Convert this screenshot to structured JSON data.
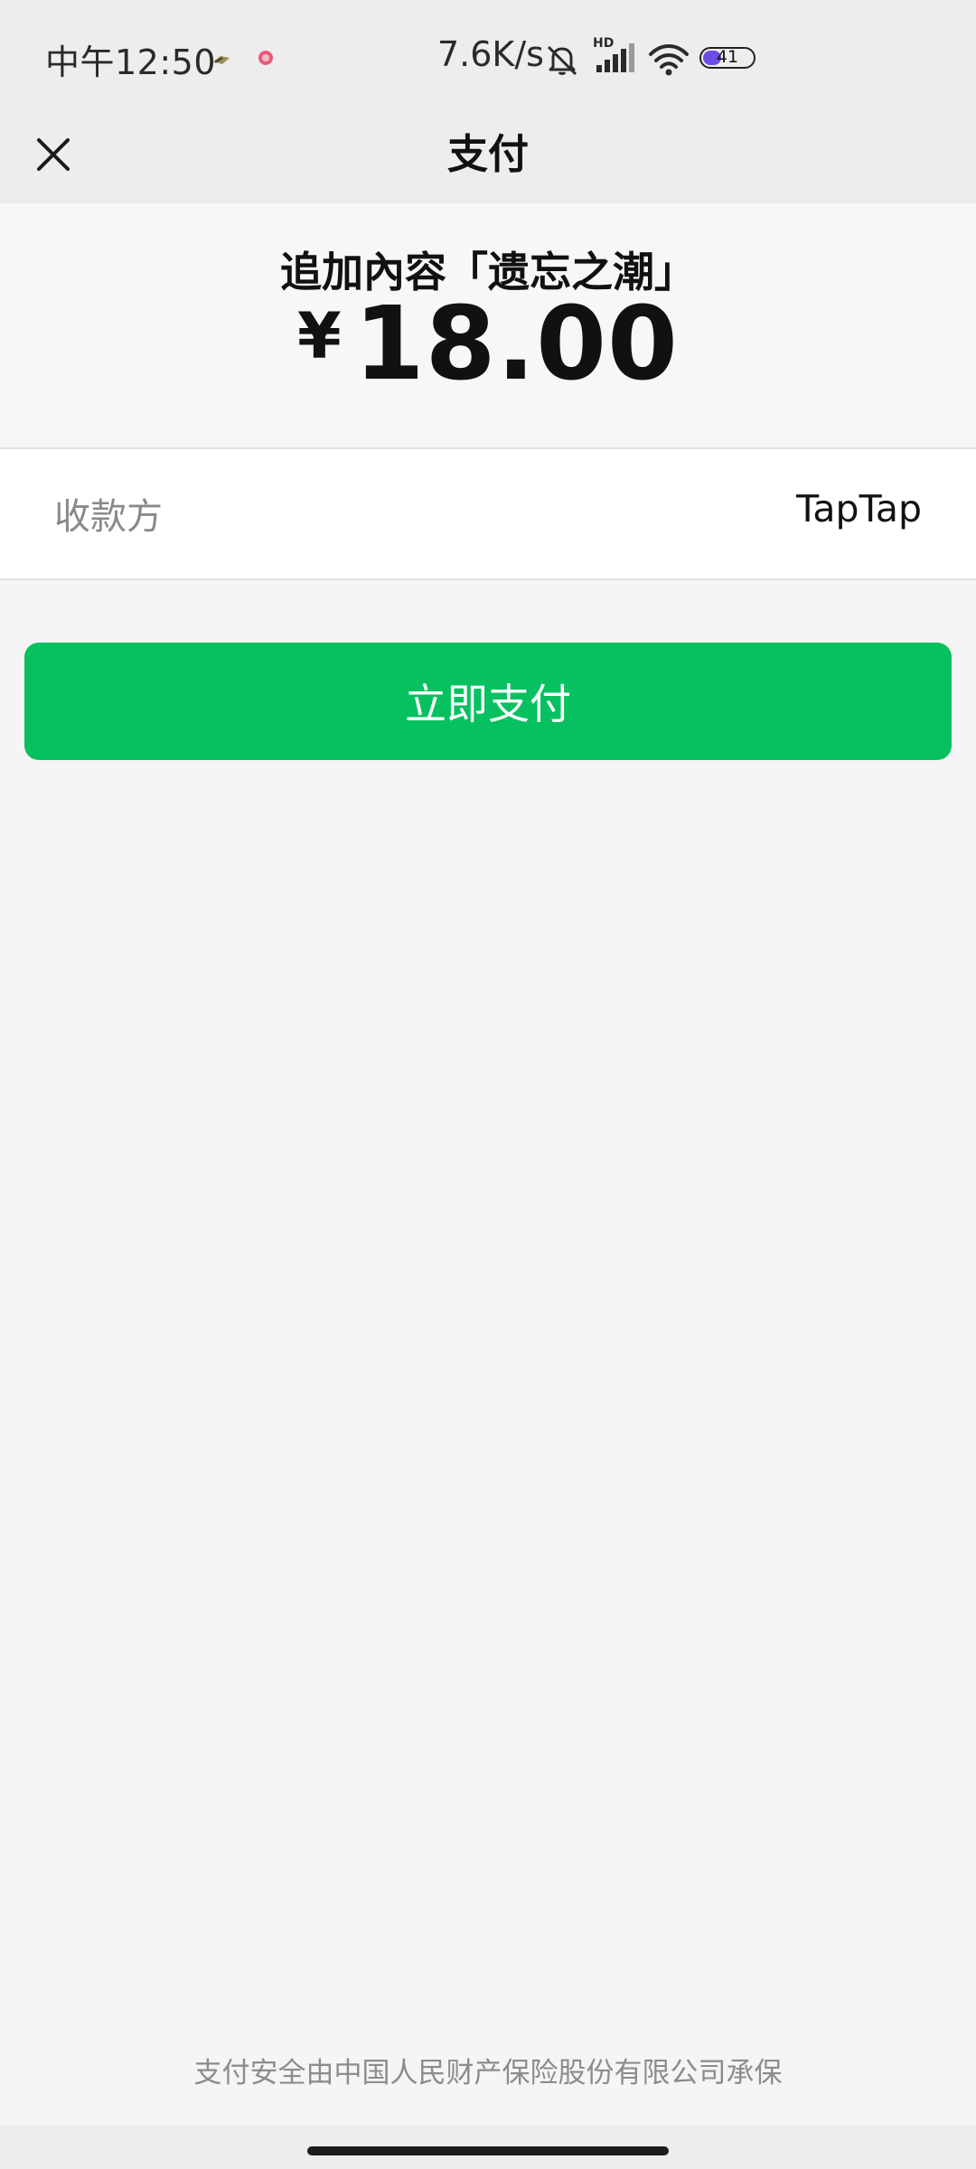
{
  "status_bar": {
    "time": "中午12:50",
    "network_speed": "7.6K/s",
    "signal_type": "HD",
    "battery_level": "41",
    "battery_fraction": 0.41,
    "icons": [
      "app-notification-icon",
      "app-notification-icon-2",
      "mute-icon",
      "hd-signal-icon",
      "wifi-icon",
      "battery-icon"
    ]
  },
  "nav": {
    "title": "支付",
    "close_icon": "close-icon"
  },
  "order": {
    "product_name": "追加內容「遗忘之潮」",
    "currency_symbol": "¥",
    "amount": "18.00"
  },
  "payee": {
    "label": "收款方",
    "value": "TapTap"
  },
  "actions": {
    "pay_button_label": "立即支付"
  },
  "footer": {
    "insurance_note": "支付安全由中国人民财产保险股份有限公司承保"
  },
  "colors": {
    "primary_green": "#07c160",
    "nav_background": "#ededed",
    "page_background": "#f5f5f5",
    "battery_accent": "#6b4de6"
  }
}
